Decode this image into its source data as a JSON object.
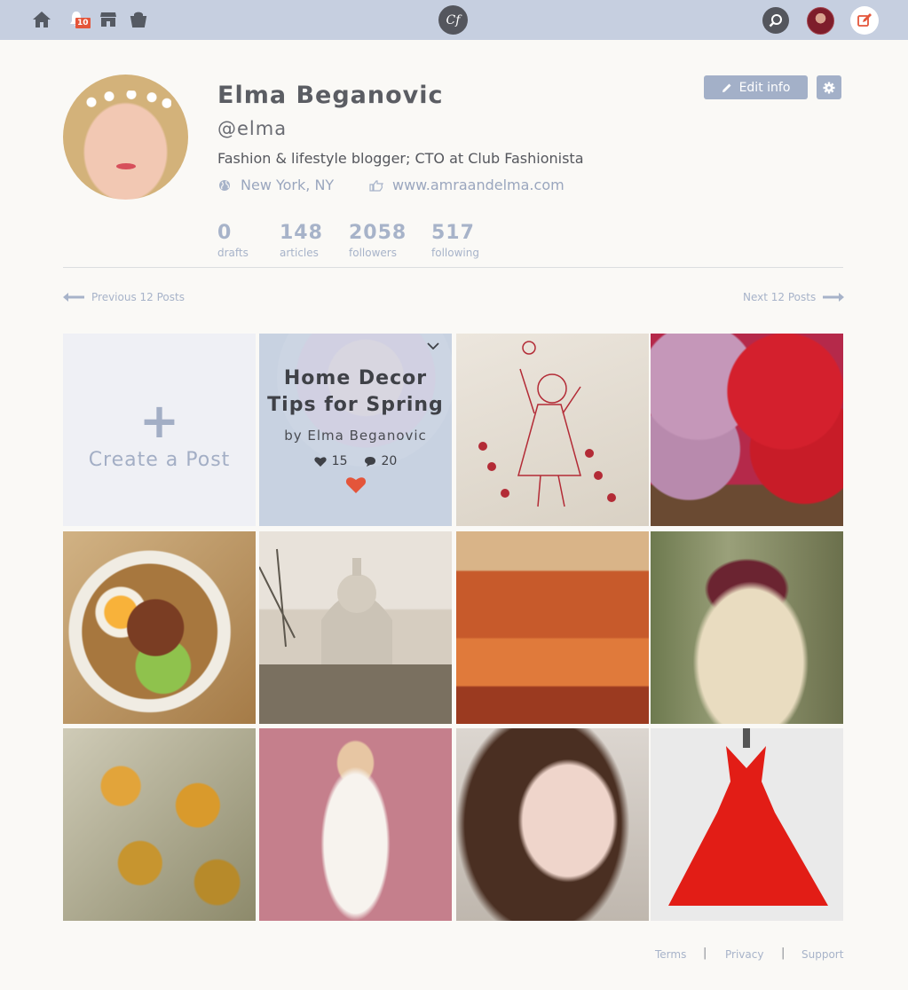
{
  "topbar": {
    "notifications_count": "10",
    "logo_text": "Cf"
  },
  "profile": {
    "name": "Elma Beganovic",
    "handle": "@elma",
    "bio": "Fashion & lifestyle blogger; CTO at Club Fashionista",
    "location": "New York, NY",
    "website": "www.amraandelma.com",
    "edit_label": "Edit info"
  },
  "stats": [
    {
      "num": "0",
      "label": "drafts"
    },
    {
      "num": "148",
      "label": "articles"
    },
    {
      "num": "2058",
      "label": "followers"
    },
    {
      "num": "517",
      "label": "following"
    }
  ],
  "pager": {
    "prev": "Previous 12 Posts",
    "next": "Next 12 Posts"
  },
  "grid": {
    "create_label": "Create a Post",
    "feature": {
      "title_line1": "Home Decor",
      "title_line2": "Tips for Spring",
      "byline": "by Elma Beganovic",
      "likes": "15",
      "comments": "20"
    }
  },
  "footer": {
    "terms": "Terms",
    "privacy": "Privacy",
    "support": "Support",
    "separator": "|"
  },
  "colors": {
    "topbar": "#c6cfe0",
    "accent": "#a3b0c8",
    "stat_text": "#a7b3c9",
    "heart": "#e4553a"
  }
}
